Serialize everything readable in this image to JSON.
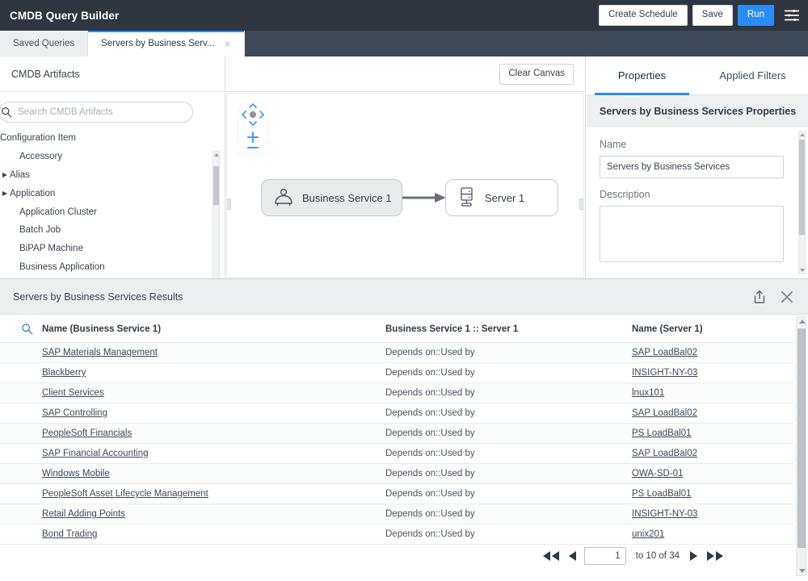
{
  "header": {
    "app_title": "CMDB Query Builder",
    "buttons": {
      "create_schedule": "Create Schedule",
      "save": "Save",
      "run": "Run"
    },
    "settings_icon": "sliders-icon",
    "accent_color": "#2a8cf4",
    "background_color": "#2f3640"
  },
  "tabs": [
    {
      "label": "Saved Queries",
      "active": false,
      "closable": false
    },
    {
      "label": "Servers by Business Serv...",
      "active": true,
      "closable": true,
      "close_glyph": "×"
    }
  ],
  "sidebar": {
    "title": "CMDB Artifacts",
    "search": {
      "placeholder": "Search CMDB Artifacts",
      "value": "",
      "icon": "search-icon"
    },
    "tree": [
      {
        "label": "Configuration Item",
        "level": 0,
        "expandable": false
      },
      {
        "label": "Accessory",
        "level": 1,
        "expandable": false
      },
      {
        "label": "Alias",
        "level": 1,
        "expandable": true
      },
      {
        "label": "Application",
        "level": 1,
        "expandable": true
      },
      {
        "label": "Application Cluster",
        "level": 1,
        "expandable": false
      },
      {
        "label": "Batch Job",
        "level": 1,
        "expandable": false
      },
      {
        "label": "BiPAP Machine",
        "level": 1,
        "expandable": false
      },
      {
        "label": "Business Application",
        "level": 1,
        "expandable": false
      }
    ]
  },
  "canvas": {
    "clear_button": "Clear Canvas",
    "pan_control_icon": "pan-zoom-control",
    "zoom_in": "+",
    "zoom_out": "−",
    "nodes": [
      {
        "label": "Business Service 1",
        "icon": "business-service-icon",
        "selected": true
      },
      {
        "label": "Server 1",
        "icon": "server-icon",
        "selected": false
      }
    ],
    "edge_direction": "left-to-right"
  },
  "properties": {
    "tabs": [
      {
        "label": "Properties",
        "active": true
      },
      {
        "label": "Applied Filters",
        "active": false
      }
    ],
    "section_title": "Servers by Business Services Properties",
    "fields": [
      {
        "label": "Name",
        "value": "Servers by Business Services",
        "type": "text"
      },
      {
        "label": "Description",
        "value": "",
        "type": "textarea"
      }
    ]
  },
  "results": {
    "title": "Servers by Business Services Results",
    "export_icon": "export-icon",
    "close_icon": "close-icon",
    "search_icon": "search-icon",
    "columns": [
      "Name (Business Service 1)",
      "Business Service 1 :: Server 1",
      "Name (Server 1)"
    ],
    "rows": [
      {
        "name": "SAP Materials Management",
        "relationship": "Depends on::Used by",
        "server": "SAP LoadBal02"
      },
      {
        "name": "Blackberry",
        "relationship": "Depends on::Used by",
        "server": "INSIGHT-NY-03"
      },
      {
        "name": "Client Services",
        "relationship": "Depends on::Used by",
        "server": "lnux101"
      },
      {
        "name": "SAP Controlling",
        "relationship": "Depends on::Used by",
        "server": "SAP LoadBal02"
      },
      {
        "name": "PeopleSoft Financials",
        "relationship": "Depends on::Used by",
        "server": "PS LoadBal01"
      },
      {
        "name": "SAP Financial Accounting",
        "relationship": "Depends on::Used by",
        "server": "SAP LoadBal02"
      },
      {
        "name": "Windows Mobile",
        "relationship": "Depends on::Used by",
        "server": "OWA-SD-01"
      },
      {
        "name": "PeopleSoft Asset Lifecycle Management",
        "relationship": "Depends on::Used by",
        "server": "PS LoadBal01"
      },
      {
        "name": "Retail Adding Points",
        "relationship": "Depends on::Used by",
        "server": "INSIGHT-NY-03"
      },
      {
        "name": "Bond Trading",
        "relationship": "Depends on::Used by",
        "server": "unix201"
      }
    ],
    "pagination": {
      "page_value": "1",
      "range_text": "to 10 of 34",
      "first_icon": "double-left-arrow-icon",
      "prev_icon": "left-arrow-icon",
      "next_icon": "right-arrow-icon",
      "last_icon": "double-right-arrow-icon"
    }
  }
}
